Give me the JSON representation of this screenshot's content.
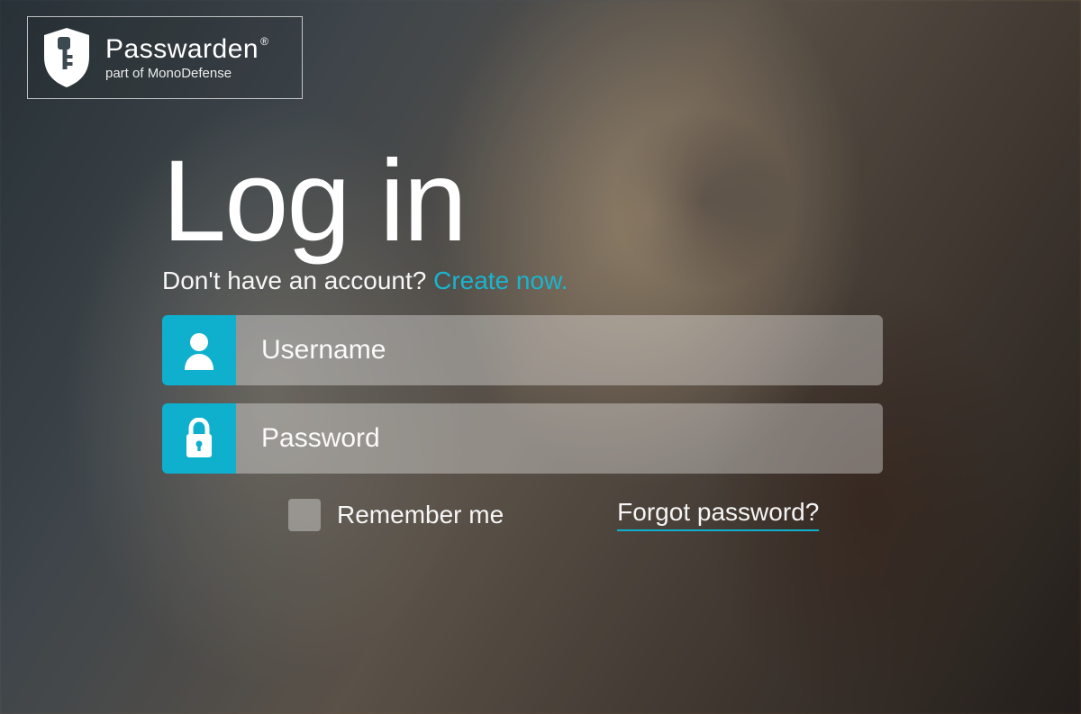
{
  "brand": {
    "name": "Passwarden",
    "tagline": "part of MonoDefense"
  },
  "login": {
    "title": "Log in",
    "no_account_text": "Don't have an account? ",
    "create_link": "Create now.",
    "username_placeholder": "Username",
    "password_placeholder": "Password",
    "remember_label": "Remember me",
    "forgot_link": "Forgot password?"
  },
  "colors": {
    "accent": "#0fb0ce"
  }
}
